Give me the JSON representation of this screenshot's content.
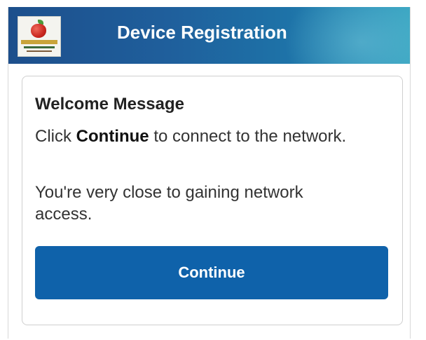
{
  "header": {
    "title": "Device Registration",
    "logo_icon": "school-apple-logo-icon"
  },
  "card": {
    "heading": "Welcome Message",
    "message1": {
      "before": "Click ",
      "bold": "Continue",
      "after": " to connect to the network."
    },
    "message2": "You're very close to gaining network access.",
    "button_label": "Continue"
  },
  "colors": {
    "header_start": "#1d4f8c",
    "header_end": "#3aa6c2",
    "button": "#0f62aa"
  }
}
